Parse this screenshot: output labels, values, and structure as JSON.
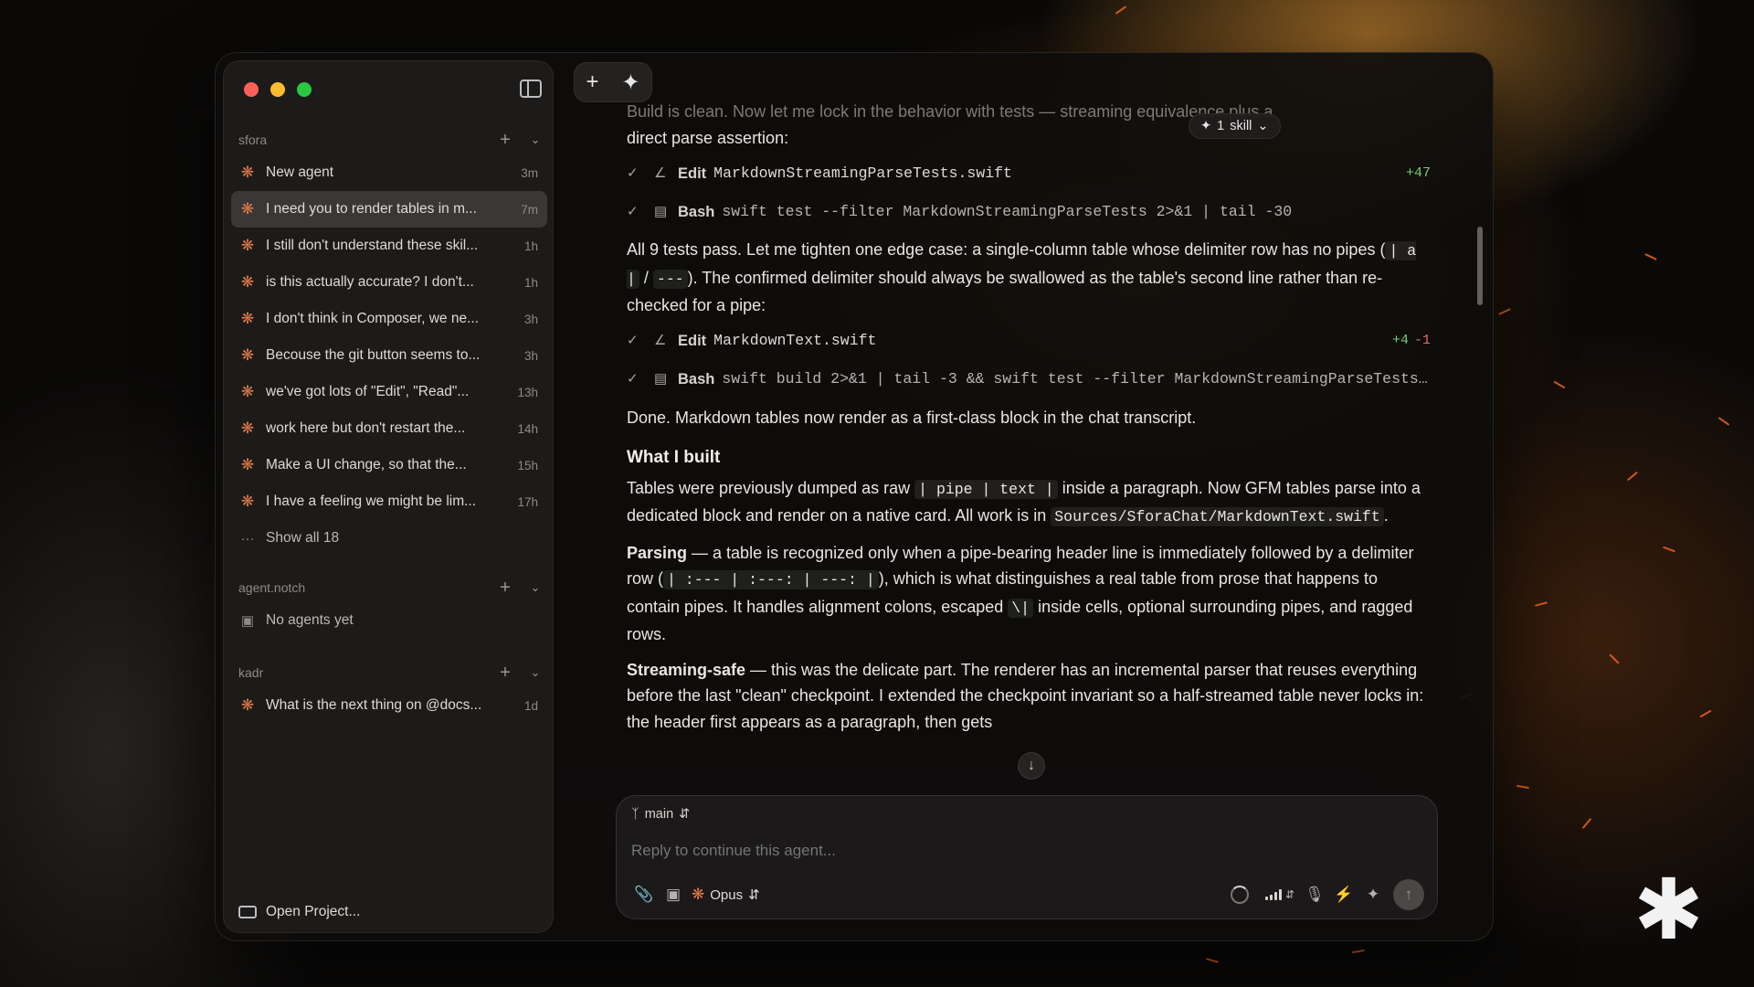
{
  "sidebar": {
    "projects": [
      {
        "name": "sfora",
        "agents": [
          {
            "title": "New agent",
            "time": "3m",
            "active": false
          },
          {
            "title": "I need you to render tables in m...",
            "time": "7m",
            "active": true
          },
          {
            "title": "I still don't understand these skil...",
            "time": "1h",
            "active": false
          },
          {
            "title": "is this actually accurate? I don't...",
            "time": "1h",
            "active": false
          },
          {
            "title": "I don't think in Composer, we ne...",
            "time": "3h",
            "active": false
          },
          {
            "title": "Becouse the git button seems to...",
            "time": "3h",
            "active": false
          },
          {
            "title": "we've got lots of \"Edit\", \"Read\"...",
            "time": "13h",
            "active": false
          },
          {
            "title": "work here but don't restart the...",
            "time": "14h",
            "active": false
          },
          {
            "title": "Make a UI change, so that the...",
            "time": "15h",
            "active": false
          },
          {
            "title": "I have a feeling we might be lim...",
            "time": "17h",
            "active": false
          }
        ],
        "show_all": "Show all 18"
      },
      {
        "name": "agent.notch",
        "empty": "No agents yet"
      },
      {
        "name": "kadr",
        "agents": [
          {
            "title": "What is the next thing on @docs...",
            "time": "1d",
            "active": false
          }
        ]
      }
    ],
    "open_project": "Open Project..."
  },
  "skill_pill": {
    "count": "1",
    "label": "skill"
  },
  "transcript": {
    "intro_faded": "Build is clean. Now let me lock in the behavior with tests — streaming equivalence plus a",
    "intro": "direct parse assertion:",
    "tool1": {
      "verb": "Edit",
      "target": "MarkdownStreamingParseTests.swift",
      "added": "+47"
    },
    "tool2": {
      "verb": "Bash",
      "target": "swift test --filter MarkdownStreamingParseTests 2>&1 | tail -30"
    },
    "para1_a": "All 9 tests pass. Let me tighten one edge case: a single-column table whose delimiter row has no pipes (",
    "para1_code1": "| a |",
    "para1_b": " / ",
    "para1_code2": "---",
    "para1_c": "). The confirmed delimiter should always be swallowed as the table's second line rather than re-checked for a pipe:",
    "tool3": {
      "verb": "Edit",
      "target": "MarkdownText.swift",
      "added": "+4",
      "removed": "-1"
    },
    "tool4": {
      "verb": "Bash",
      "target": "swift build 2>&1 | tail -3 && swift test --filter MarkdownStreamingParseTests..."
    },
    "done": "Done. Markdown tables now render as a first-class block in the chat transcript.",
    "heading": "What I built",
    "para2_a": "Tables were previously dumped as raw ",
    "para2_code1": "| pipe | text |",
    "para2_b": " inside a paragraph. Now GFM tables parse into a dedicated block and render on a native card. All work is in ",
    "para2_code2": "Sources/SforaChat/MarkdownText.swift",
    "para2_c": ".",
    "parsing_label": "Parsing",
    "parsing_a": " — a table is recognized only when a pipe-bearing header line is immediately followed by a delimiter row (",
    "parsing_code1": "| :--- | :---: | ---: |",
    "parsing_b": "), which is what distinguishes a real table from prose that happens to contain pipes. It handles alignment colons, escaped ",
    "parsing_code2": "\\|",
    "parsing_c": " inside cells, optional surrounding pipes, and ragged rows.",
    "streaming_label": "Streaming-safe",
    "streaming_text": " — this was the delicate part. The renderer has an incremental parser that reuses everything before the last \"clean\" checkpoint. I extended the checkpoint invariant so a half-streamed table never locks in: the header first appears as a paragraph, then gets"
  },
  "composer": {
    "branch": "main",
    "placeholder": "Reply to continue this agent...",
    "model": "Opus"
  },
  "colors": {
    "accent": "#e07a4a",
    "added": "#6fd07a",
    "removed": "#e06c6c"
  }
}
